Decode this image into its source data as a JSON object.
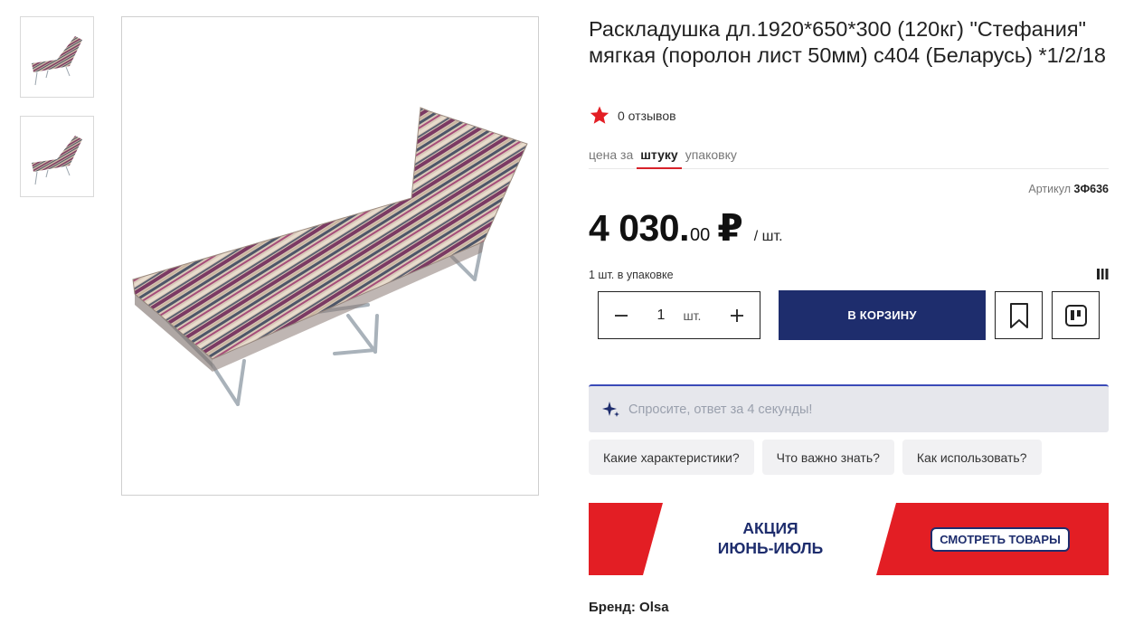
{
  "product": {
    "title": "Раскладушка дл.1920*650*300 (120кг) \"Стефания\" мягкая (поролон лист 50мм) с404 (Беларусь) *1/2/18",
    "reviews_count": "0 отзывов",
    "price_tabs": {
      "label": "цена за",
      "active": "штуку",
      "inactive": "упаковку"
    },
    "sku_label": "Артикул",
    "sku_value": "3Ф636",
    "price_main": "4 030.",
    "price_cents": "00",
    "price_currency": "₽",
    "price_unit": "/ шт.",
    "pack_info": "1 шт. в упаковке",
    "quantity": "1",
    "quantity_unit": "шт.",
    "cart_button": "В КОРЗИНУ",
    "brand": "Бренд: Olsa"
  },
  "ask": {
    "placeholder": "Спросите, ответ за 4 секунды!",
    "chips": [
      "Какие характеристики?",
      "Что важно знать?",
      "Как использовать?"
    ]
  },
  "promo": {
    "line1": "АКЦИЯ",
    "line2": "ИЮНЬ-ИЮЛЬ",
    "button": "СМОТРЕТЬ ТОВАРЫ"
  },
  "colors": {
    "accent_red": "#e31e24",
    "brand_navy": "#1e2d6d"
  },
  "icons": {
    "rating": "star-icon",
    "decrease": "minus-icon",
    "increase": "plus-icon",
    "favorite": "bookmark-icon",
    "compare": "compare-icon",
    "barcode": "barcode-icon",
    "ai": "sparkle-icon"
  }
}
